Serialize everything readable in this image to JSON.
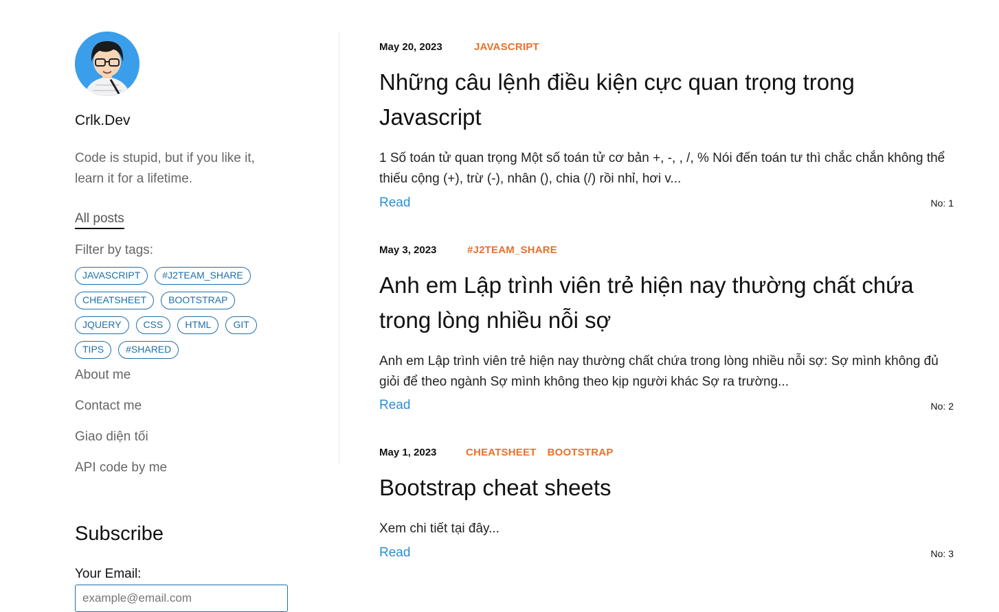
{
  "site": {
    "brand": "Crlk.Dev",
    "tagline": "Code is stupid, but if you like it, learn it for a lifetime.",
    "accent_color": "#1f6fa8",
    "tag_color": "#e8712b",
    "link_color": "#2a8fd5"
  },
  "sidebar": {
    "all_posts": "All posts",
    "filter_label": "Filter by tags:",
    "tags": [
      "JAVASCRIPT",
      "#J2TEAM_SHARE",
      "CHEATSHEET",
      "BOOTSTRAP",
      "JQUERY",
      "CSS",
      "HTML",
      "GIT",
      "TIPS",
      "#SHARED"
    ],
    "links": [
      "About me",
      "Contact me",
      "Giao diện tối",
      "API code by me"
    ]
  },
  "subscribe": {
    "title": "Subscribe",
    "email_label": "Your Email:",
    "email_placeholder": "example@email.com"
  },
  "posts": [
    {
      "date": "May 20, 2023",
      "tags": [
        "JAVASCRIPT"
      ],
      "title": "Những câu lệnh điều kiện cực quan trọng trong Javascript",
      "excerpt": "1 Số toán tử quan trọng Một số toán tử cơ bản +, -, , /, % Nói đến toán tư thì chắc chắn không thể thiếu cộng (+), trừ (-), nhân (), chia (/) rồi nhỉ, hơi v...",
      "read": "Read",
      "number": "No: 1"
    },
    {
      "date": "May 3, 2023",
      "tags": [
        "#J2TEAM_SHARE"
      ],
      "title": "Anh em Lập trình viên trẻ hiện nay thường chất chứa trong lòng nhiều nỗi sợ",
      "excerpt": "Anh em Lập trình viên trẻ hiện nay thường chất chứa trong lòng nhiều nỗi sợ: Sợ mình không đủ giỏi để theo ngành Sợ mình không theo kịp người khác Sợ ra trường...",
      "read": "Read",
      "number": "No: 2"
    },
    {
      "date": "May 1, 2023",
      "tags": [
        "CHEATSHEET",
        "BOOTSTRAP"
      ],
      "title": "Bootstrap cheat sheets",
      "excerpt": "Xem chi tiết tại đây...",
      "read": "Read",
      "number": "No: 3"
    }
  ]
}
